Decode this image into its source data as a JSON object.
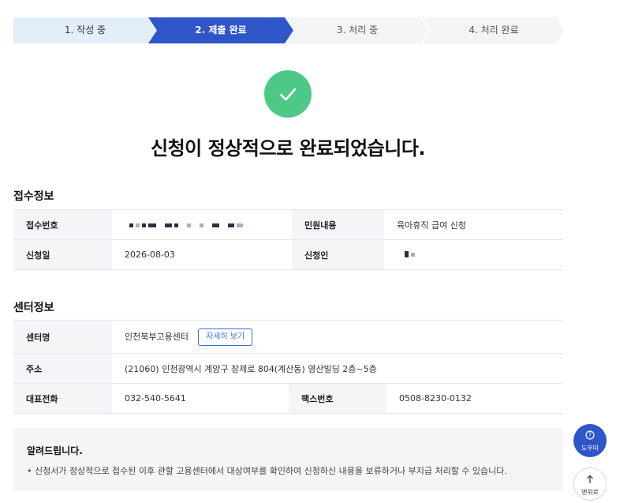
{
  "steps": [
    {
      "label": "1. 작성 중",
      "state": "done"
    },
    {
      "label": "2. 제출 완료",
      "state": "active"
    },
    {
      "label": "3. 처리 중",
      "state": "pending"
    },
    {
      "label": "4. 처리 완료",
      "state": "pending"
    }
  ],
  "colors": {
    "step_done_bg": "#e3eefb",
    "step_active_bg": "#2f56c8",
    "step_pending_bg": "#f3f4f6",
    "success_green": "#4cc987",
    "accent_blue": "#3b6fd8"
  },
  "success": {
    "icon": "checkmark-icon",
    "headline": "신청이 정상적으로 완료되었습니다."
  },
  "receipt": {
    "title": "접수정보",
    "receipt_no_label": "접수번호",
    "complaint_label": "민원내용",
    "complaint_value": "육아휴직 급여 신청",
    "date_label": "신청일",
    "date_value": "2026-08-03",
    "applicant_label": "신청인"
  },
  "center": {
    "title": "센터정보",
    "name_label": "센터명",
    "name_value": "인천북부고용센터",
    "detail_button": "자세히 보기",
    "address_label": "주소",
    "address_value": "(21060) 인천광역시 계양구 장제로 804(계산동) 영산빌딩 2층~5층",
    "phone_label": "대표전화",
    "phone_value": "032-540-5641",
    "fax_label": "팩스번호",
    "fax_value": "0508-8230-0132"
  },
  "notice": {
    "title": "알려드립니다.",
    "text": "• 신청서가 정상적으로 접수된 이후 관할 고용센터에서 대상여부를 확인하여 신청하신 내용을 보류하거나 부지급 처리할 수 있습니다."
  },
  "floating": {
    "help_icon": "question-circle-icon",
    "help_label": "도우미",
    "top_icon": "arrow-up-icon",
    "top_label": "맨위로"
  }
}
